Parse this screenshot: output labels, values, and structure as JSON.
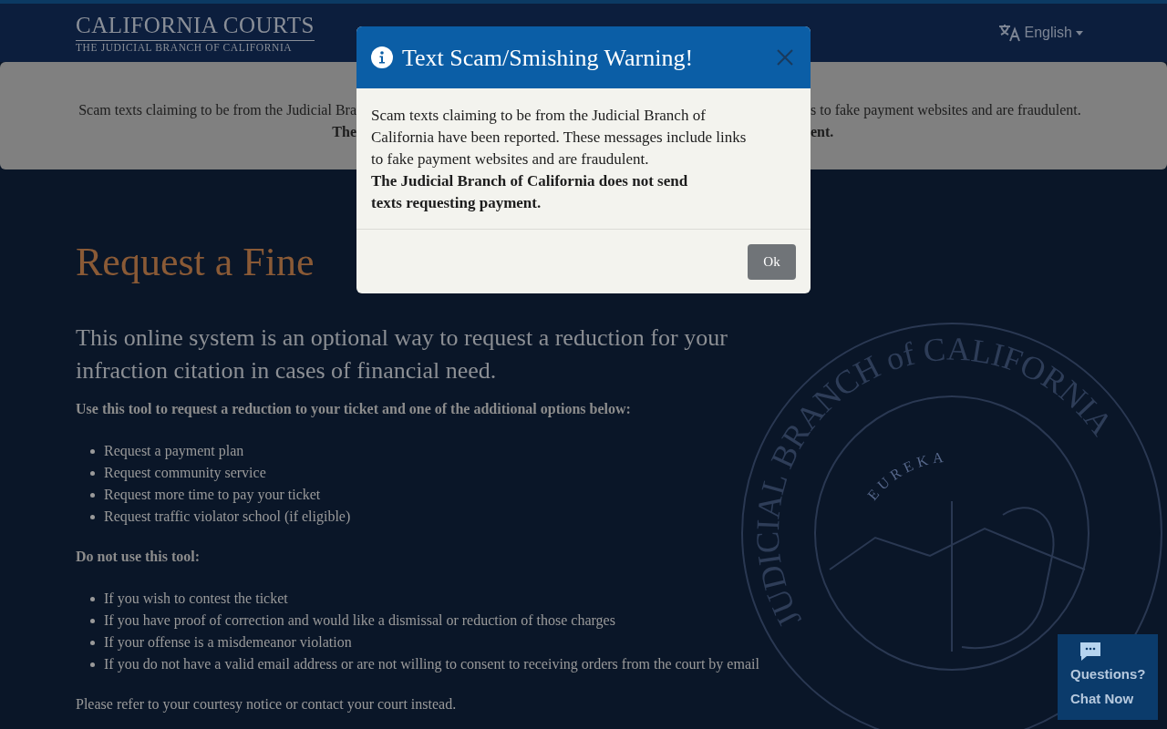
{
  "header": {
    "logo_title": "CALIFORNIA COURTS",
    "logo_subtitle": "THE JUDICIAL BRANCH OF CALIFORNIA",
    "language": "English"
  },
  "banner": {
    "line_1_left": "Scam texts claiming to be from the Judicial Bra",
    "line_1_right": "s to fake payment websites and are fraudulent.",
    "line_2_left": "The",
    "line_2_right": "ent."
  },
  "page": {
    "title": "Request a Fine",
    "lead": "This online system is an optional way to request a reduction for your infraction citation in cases of financial need.",
    "use_heading": "Use this tool to request a reduction to your ticket and one of the additional options below:",
    "use_items": [
      "Request a payment plan",
      "Request community service",
      "Request more time to pay your ticket",
      "Request traffic violator school (if eligible)"
    ],
    "avoid_heading": "Do not use this tool:",
    "avoid_items": [
      "If you wish to contest the ticket",
      "If you have proof of correction and would like a dismissal or reduction of those charges",
      "If your offense is a misdemeanor violation",
      "If you do not have a valid email address or are not willing to consent to receiving orders from the court by email"
    ],
    "footer_note": "Please refer to your courtesy notice or contact your court instead."
  },
  "seal": {
    "ring_text": "JUDICIAL BRANCH of CALIFORNIA",
    "motto": "EUREKA"
  },
  "chat": {
    "line_1": "Questions?",
    "line_2": "Chat Now"
  },
  "modal": {
    "title": "Text Scam/Smishing Warning!",
    "body": "Scam texts claiming to be from the Judicial Branch of California have been reported. These messages include links to fake payment websites and are fraudulent.",
    "body_bold": "The Judicial Branch of California does not send texts requesting payment.",
    "button": "Ok"
  }
}
